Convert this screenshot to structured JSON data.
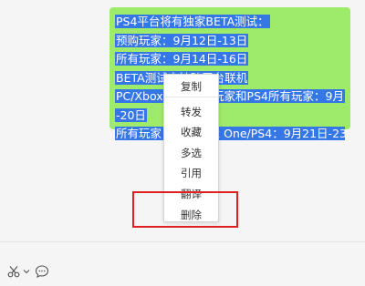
{
  "message": {
    "lines": [
      "PS4平台将有独家BETA测试：",
      "预购玩家：9月12日-13日",
      "所有玩家：9月14日-16日",
      "BETA测试支持跨平台联机",
      "PC/Xbox One预购玩家和PS4所有玩家：9月19日",
      "-20日",
      "所有玩家：PC/Xbox One/PS4：9月21日-23日"
    ],
    "selection_color": "#3578e5",
    "bubble_color": "#9eea6a"
  },
  "context_menu": {
    "items": [
      "复制",
      "转发",
      "收藏",
      "多选",
      "引用",
      "翻译",
      "删除"
    ]
  },
  "annotation": {
    "highlighted_item": "删除",
    "color": "#e02020"
  },
  "toolbar": {
    "icons": [
      "scissors-icon",
      "chevron-down-icon",
      "chat-bubble-icon"
    ]
  }
}
